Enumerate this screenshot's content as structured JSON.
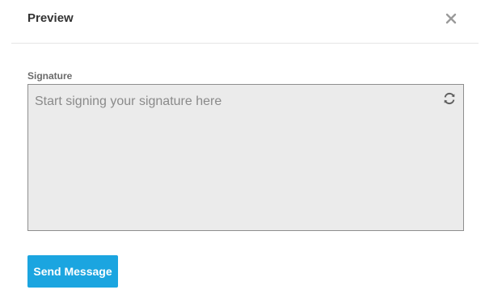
{
  "header": {
    "title": "Preview",
    "close_icon": "close-icon"
  },
  "signature": {
    "label": "Signature",
    "placeholder": "Start signing your signature here",
    "refresh_icon": "refresh-icon",
    "pad_color": "#ebebeb"
  },
  "actions": {
    "send_label": "Send Message",
    "send_color": "#1ba5e0"
  }
}
